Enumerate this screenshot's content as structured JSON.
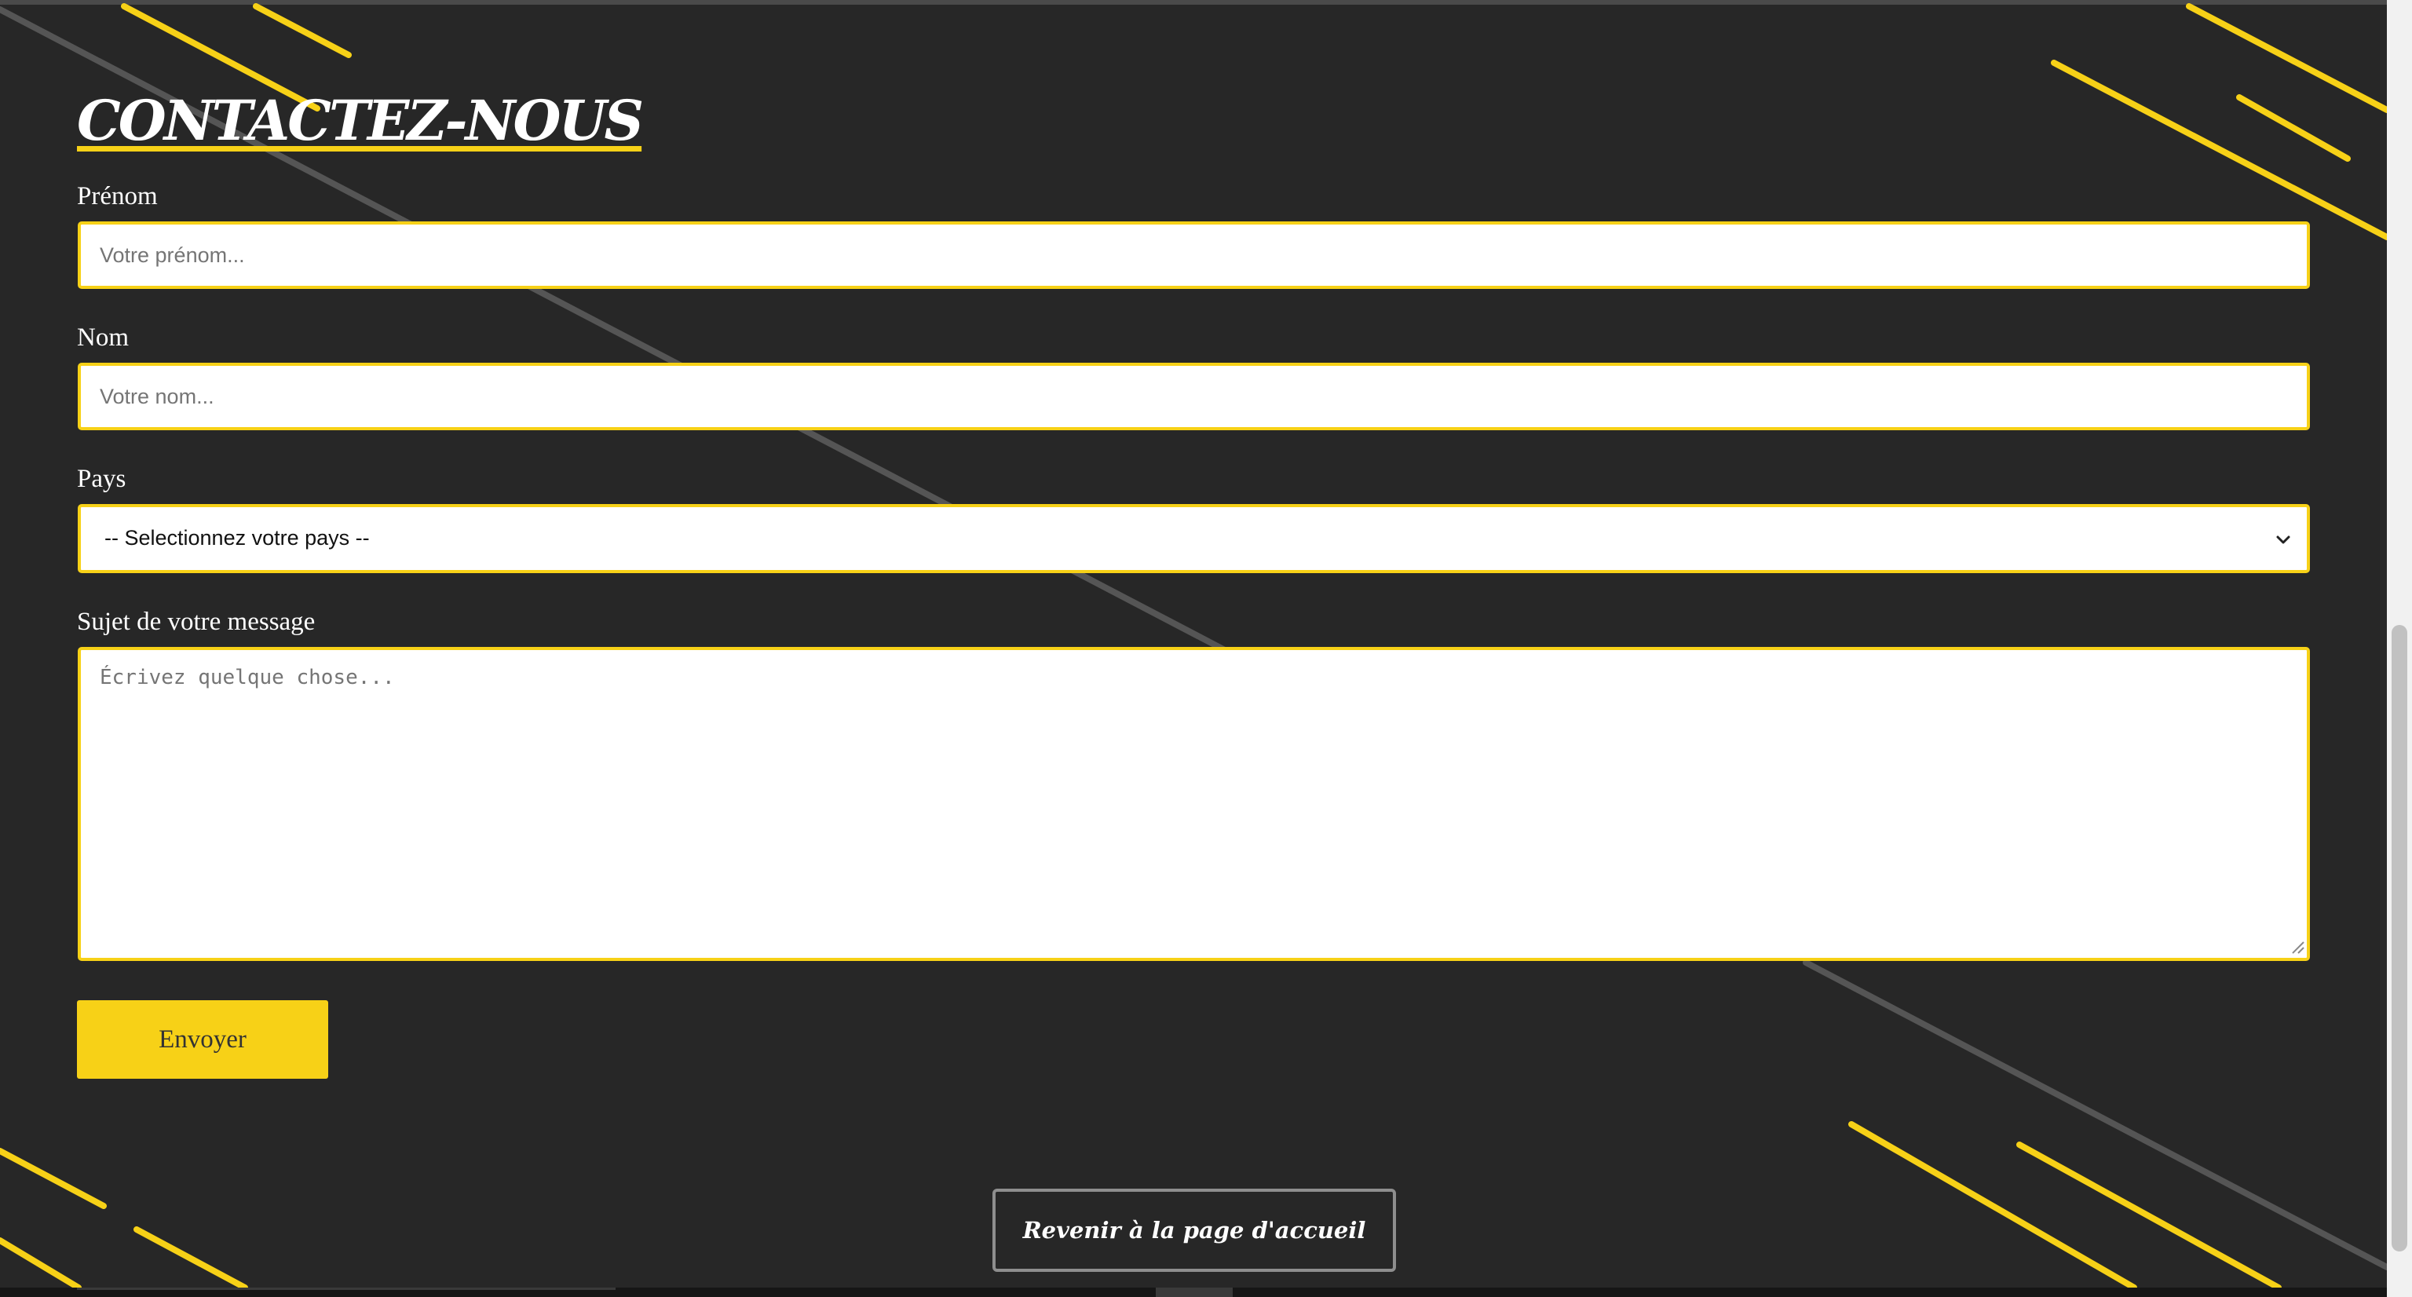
{
  "page": {
    "title": "CONTACTEZ-NOUS",
    "accent_color": "#f7d117",
    "background_color": "#272727"
  },
  "form": {
    "firstname": {
      "label": "Prénom",
      "placeholder": "Votre prénom...",
      "value": ""
    },
    "lastname": {
      "label": "Nom",
      "placeholder": "Votre nom...",
      "value": ""
    },
    "country": {
      "label": "Pays",
      "selected": "-- Selectionnez votre pays --",
      "icon": "chevron-down-icon"
    },
    "subject": {
      "label": "Sujet de votre message",
      "placeholder": "Écrivez quelque chose...",
      "value": ""
    },
    "submit_label": "Envoyer"
  },
  "footer": {
    "home_link_label": "Revenir à la page d'accueil"
  }
}
